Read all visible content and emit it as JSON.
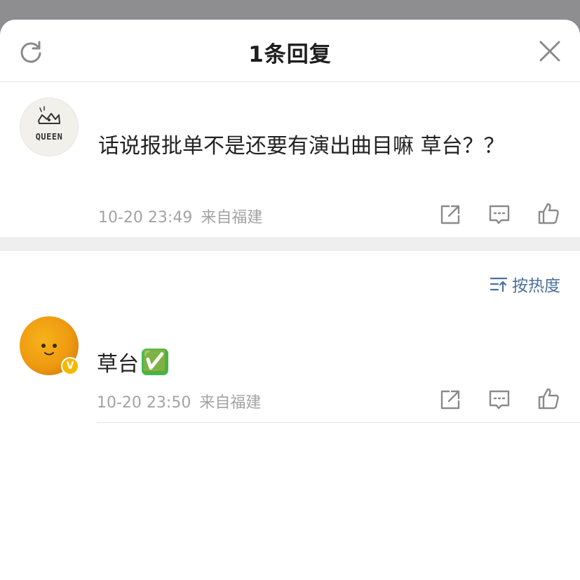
{
  "header": {
    "title": "1条回复",
    "refresh_icon": "refresh-icon",
    "close_icon": "close-icon"
  },
  "root_comment": {
    "avatar_label": "QUEEN",
    "text": "话说报批单不是还要有演出曲目嘛 草台？？",
    "time": "10-20 23:49",
    "location": "来自福建"
  },
  "sort": {
    "icon": "sort-icon",
    "label": "按热度"
  },
  "replies": [
    {
      "text": "草台",
      "emoji": "✅",
      "verified_badge": "V",
      "time": "10-20 23:50",
      "location": "来自福建"
    }
  ],
  "actions": {
    "share_icon": "share-icon",
    "comment_icon": "comment-icon",
    "like_icon": "like-icon"
  },
  "colors": {
    "overlay": "#8e8d8f",
    "link_blue": "#4b6f9d",
    "meta_gray": "#a3a3a3",
    "badge_yellow": "#f5b700",
    "check_green": "#3dba4e"
  }
}
